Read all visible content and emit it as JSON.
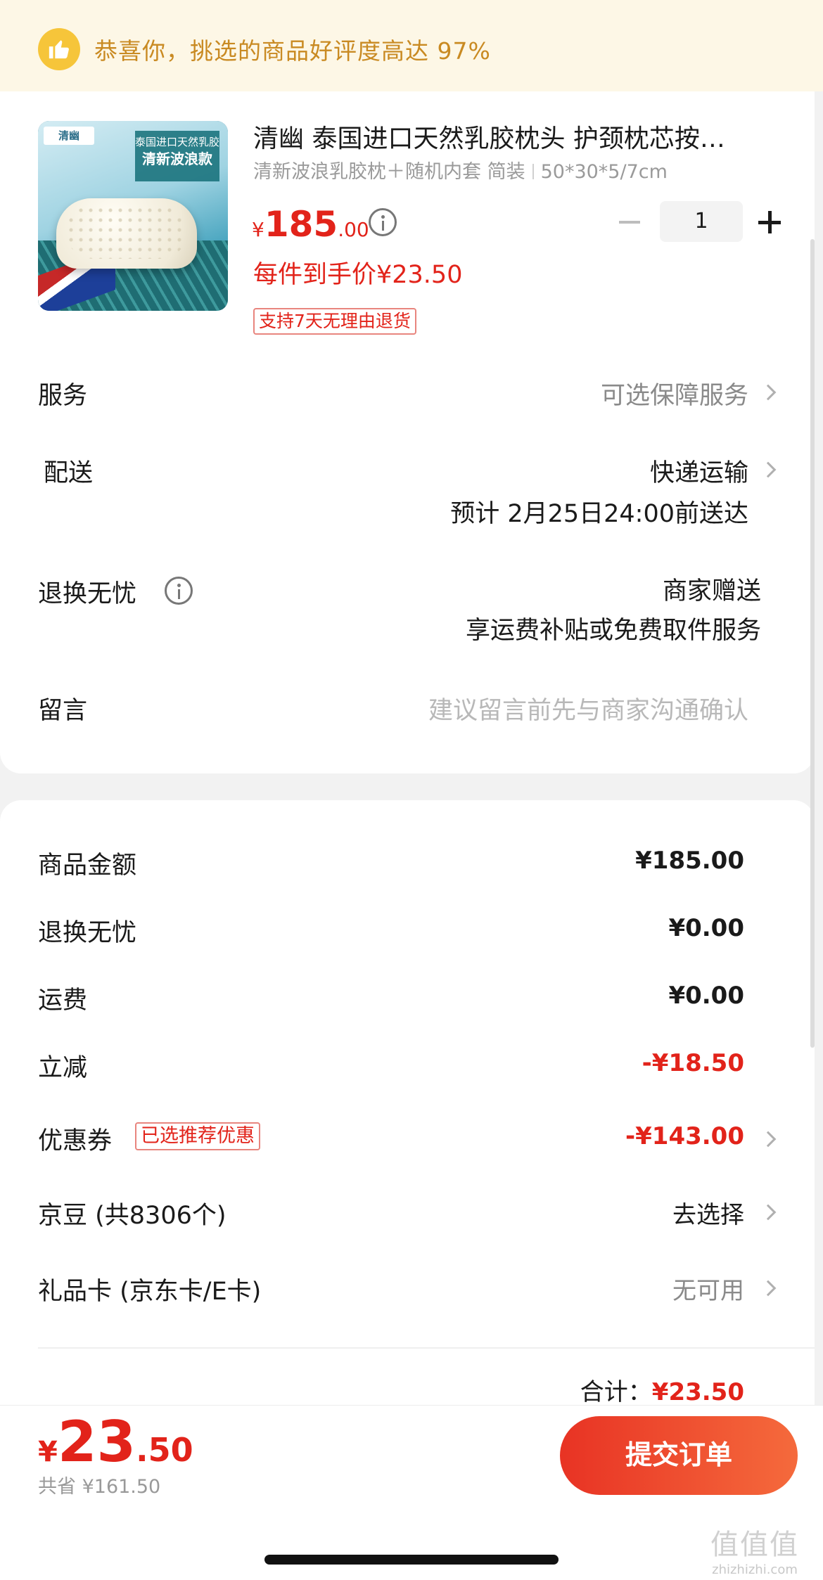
{
  "banner": {
    "text": "恭喜你，挑选的商品好评度高达 97%",
    "icon": "thumbs-up-icon"
  },
  "product": {
    "image_logo": "清幽",
    "image_badge_top": "泰国进口天然乳胶",
    "image_badge_main": "清新波浪款",
    "title": "清幽 泰国进口天然乳胶枕头 护颈枕芯按…",
    "spec_variant": "清新波浪乳胶枕＋随机内套 简装",
    "spec_size": "50*30*5/7cm",
    "price_currency": "¥",
    "price_int": "185",
    "price_dec": ".00",
    "quantity": "1",
    "per_item_price": "每件到手价¥23.50",
    "return_tag": "支持7天无理由退货"
  },
  "rows": {
    "service_label": "服务",
    "service_value": "可选保障服务",
    "delivery_label": "配送",
    "delivery_method": "快递运输",
    "delivery_eta": "预计 2月25日24:00前送达",
    "return_label": "退换无忧",
    "return_value_1": "商家赠送",
    "return_value_2": "享运费补贴或免费取件服务",
    "note_label": "留言",
    "note_placeholder": "建议留言前先与商家沟通确认"
  },
  "summary": {
    "goods_label": "商品金额",
    "goods_value": "¥185.00",
    "return_label": "退换无忧",
    "return_value": "¥0.00",
    "shipping_label": "运费",
    "shipping_value": "¥0.00",
    "discount_label": "立减",
    "discount_value": "-¥18.50",
    "coupon_label": "优惠券",
    "coupon_tag": "已选推荐优惠",
    "coupon_value": "-¥143.00",
    "beans_label": "京豆 (共8306个)",
    "beans_value": "去选择",
    "giftcard_label": "礼品卡 (京东卡/E卡)",
    "giftcard_value": "无可用",
    "subtotal_label": "合计：",
    "subtotal_value": "¥23.50"
  },
  "footer": {
    "total_currency": "¥",
    "total_int": "23",
    "total_dec": ".50",
    "saved": "共省 ¥161.50",
    "submit_label": "提交订单"
  },
  "watermark": {
    "big": "值值值",
    "small": "zhizhizhi.com"
  },
  "colors": {
    "accent_red": "#e2231a",
    "banner_bg": "#fdf7e6",
    "banner_text": "#c98a22"
  }
}
